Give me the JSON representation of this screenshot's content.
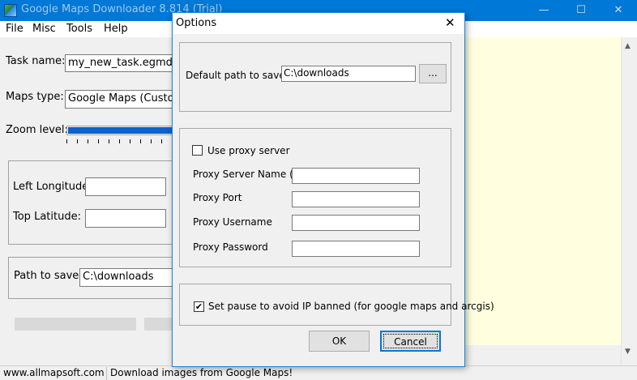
{
  "window": {
    "title": "Google Maps Downloader 8.814 (Trial)",
    "minimize_glyph": "—",
    "maximize_glyph": "☐",
    "close_glyph": "✕"
  },
  "menu": {
    "items": [
      "File",
      "Misc",
      "Tools",
      "Help"
    ]
  },
  "main": {
    "task_name_label": "Task name:",
    "task_name_value": "my_new_task.egmd",
    "maps_type_label": "Maps type:",
    "maps_type_value": "Google Maps (Customiz",
    "zoom_label": "Zoom level:",
    "left_longitude_label": "Left Longitude:",
    "left_longitude_value": "",
    "top_latitude_label": "Top Latitude:",
    "top_latitude_value": "",
    "path_label": "Path to save:",
    "path_value": "C:\\downloads"
  },
  "scrollbar": {
    "up": "▲",
    "down": "▼"
  },
  "status": {
    "website": "www.allmapsoft.com",
    "message": "Download images from Google Maps!"
  },
  "options_dialog": {
    "title": "Options",
    "close_glyph": "✕",
    "default_path_label": "Default path to save :",
    "default_path_value": "C:\\downloads",
    "browse_label": "...",
    "use_proxy_label": "Use proxy server",
    "use_proxy_checked": false,
    "proxy_server_label": "Proxy Server Name (IP)",
    "proxy_server_value": "",
    "proxy_port_label": "Proxy Port",
    "proxy_port_value": "",
    "proxy_username_label": "Proxy Username",
    "proxy_username_value": "",
    "proxy_password_label": "Proxy Password",
    "proxy_password_value": "",
    "pause_label": "Set pause to avoid IP banned (for google maps and arcgis)",
    "pause_checked": true,
    "check_glyph": "✔",
    "ok_label": "OK",
    "cancel_label": "Cancel"
  },
  "colors": {
    "titlebar": "#0078d7",
    "preview_background": "#ffffe0",
    "zoom_fill": "#0a63c9"
  }
}
